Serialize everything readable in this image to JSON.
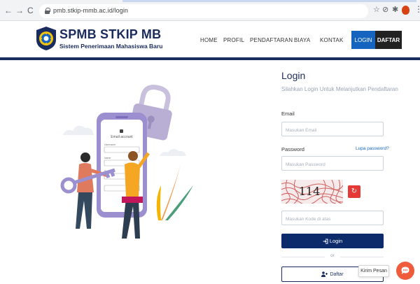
{
  "browser": {
    "url": "pmb.stkip-mmb.ac.id/login",
    "back_icon": "←",
    "forward_icon": "→",
    "reload_icon": "C",
    "star_icon": "☆",
    "extension_icon": "⊘",
    "puzzle_icon": "✱",
    "menu_icon": "⋮"
  },
  "header": {
    "title": "SPMB STKIP MB",
    "subtitle": "Sistem Penerimaan Mahasiswa Baru",
    "nav": [
      "HOME",
      "PROFIL",
      "PENDAFTARAN",
      "BIAYA",
      "KONTAK"
    ],
    "login_label": "LOGIN",
    "daftar_label": "DAFTAR"
  },
  "illustration": {
    "phone_title": "Email account",
    "fields": [
      "Username",
      "Name",
      "Password"
    ]
  },
  "form": {
    "title": "Login",
    "subtitle": "Silahkan Login Untuk Melanjutkan Pendaftaran",
    "email_label": "Email",
    "email_placeholder": "Masukan Email",
    "password_label": "Password",
    "password_placeholder": "Masukan Password",
    "forgot_label": "Lupa password?",
    "captcha_text": "114",
    "captcha_placeholder": "Masukan Kode di atas",
    "login_button": "Login",
    "or_text": "or",
    "daftar_button": "Daftar"
  },
  "chat": {
    "tooltip": "Kirim Pesan"
  },
  "colors": {
    "brand_navy": "#1a2b5e",
    "login_blue": "#1565c0",
    "refresh_red": "#e53935",
    "chat_orange": "#ef5b3b"
  }
}
